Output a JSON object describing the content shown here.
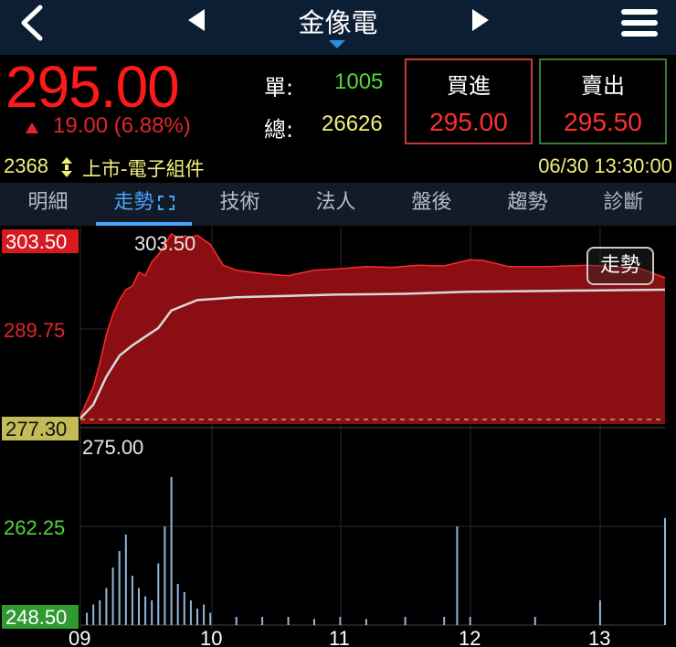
{
  "header": {
    "title": "金像電",
    "back_icon": "chevron-left-icon",
    "prev_icon": "triangle-left-icon",
    "next_icon": "triangle-right-icon",
    "menu_icon": "hamburger-menu-icon",
    "dropdown_icon": "caret-down-icon"
  },
  "quote": {
    "price": "295.00",
    "change": "19.00 (6.88%)",
    "single_label": "單:",
    "single_value": "1005",
    "total_label": "總:",
    "total_value": "26626",
    "buy_label": "買進",
    "buy_price": "295.00",
    "sell_label": "賣出",
    "sell_price": "295.50"
  },
  "info": {
    "code": "2368",
    "market": "上市-電子組件",
    "datetime": "06/30 13:30:00"
  },
  "tabs": [
    {
      "label": "明細"
    },
    {
      "label": "走勢"
    },
    {
      "label": "技術"
    },
    {
      "label": "法人"
    },
    {
      "label": "盤後"
    },
    {
      "label": "趨勢"
    },
    {
      "label": "診斷"
    }
  ],
  "active_tab": "走勢",
  "mode_button": "走勢",
  "colors": {
    "up": "#ff1a1a",
    "area": "#8b0f12",
    "avg_line": "#d8d8d8",
    "volume": "#8fb7df",
    "green": "#55d43f",
    "yellow": "#f3ef7c"
  },
  "chart_data": {
    "type": "line",
    "price_axis_labels": [
      "303.50",
      "289.75",
      "277.30"
    ],
    "volume_axis_labels": [
      "275.00",
      "262.25",
      "248.50"
    ],
    "high_annotation": "303.50",
    "x_labels": [
      "09",
      "10",
      "11",
      "12",
      "13"
    ],
    "price_range": [
      276.2,
      303.5
    ],
    "reference_price": 276.0,
    "price_series": [
      [
        9.0,
        277.3
      ],
      [
        9.05,
        279.5
      ],
      [
        9.1,
        281.5
      ],
      [
        9.15,
        285.0
      ],
      [
        9.2,
        289.0
      ],
      [
        9.25,
        292.0
      ],
      [
        9.3,
        294.0
      ],
      [
        9.35,
        295.5
      ],
      [
        9.4,
        296.0
      ],
      [
        9.45,
        298.0
      ],
      [
        9.5,
        297.5
      ],
      [
        9.55,
        299.5
      ],
      [
        9.6,
        300.5
      ],
      [
        9.65,
        302.0
      ],
      [
        9.7,
        303.5
      ],
      [
        9.75,
        303.0
      ],
      [
        9.8,
        303.2
      ],
      [
        9.85,
        303.0
      ],
      [
        9.9,
        303.3
      ],
      [
        10.0,
        302.0
      ],
      [
        10.1,
        299.0
      ],
      [
        10.2,
        298.3
      ],
      [
        10.4,
        297.8
      ],
      [
        10.6,
        297.5
      ],
      [
        10.8,
        298.3
      ],
      [
        11.0,
        298.5
      ],
      [
        11.2,
        298.8
      ],
      [
        11.4,
        298.7
      ],
      [
        11.6,
        299.0
      ],
      [
        11.8,
        298.9
      ],
      [
        12.0,
        299.8
      ],
      [
        12.1,
        299.7
      ],
      [
        12.3,
        298.8
      ],
      [
        12.6,
        298.8
      ],
      [
        12.9,
        299.0
      ],
      [
        13.1,
        298.8
      ],
      [
        13.3,
        298.6
      ],
      [
        13.5,
        297.2
      ]
    ],
    "avg_series": [
      [
        9.0,
        277.0
      ],
      [
        9.1,
        279.0
      ],
      [
        9.2,
        283.0
      ],
      [
        9.3,
        286.0
      ],
      [
        9.4,
        287.5
      ],
      [
        9.6,
        290.0
      ],
      [
        9.7,
        292.5
      ],
      [
        9.9,
        294.0
      ],
      [
        10.2,
        294.4
      ],
      [
        10.6,
        294.6
      ],
      [
        11.0,
        294.8
      ],
      [
        11.5,
        294.9
      ],
      [
        12.0,
        295.2
      ],
      [
        12.5,
        295.3
      ],
      [
        13.0,
        295.4
      ],
      [
        13.5,
        295.5
      ]
    ],
    "volume": [
      [
        9.05,
        3
      ],
      [
        9.1,
        5
      ],
      [
        9.15,
        6
      ],
      [
        9.2,
        9
      ],
      [
        9.25,
        14
      ],
      [
        9.3,
        18
      ],
      [
        9.35,
        22
      ],
      [
        9.4,
        12
      ],
      [
        9.45,
        9
      ],
      [
        9.5,
        7
      ],
      [
        9.55,
        6
      ],
      [
        9.6,
        15
      ],
      [
        9.65,
        24
      ],
      [
        9.7,
        36
      ],
      [
        9.75,
        10
      ],
      [
        9.8,
        8
      ],
      [
        9.85,
        6
      ],
      [
        9.9,
        4
      ],
      [
        9.95,
        5
      ],
      [
        10.0,
        3
      ],
      [
        10.2,
        2
      ],
      [
        10.4,
        2
      ],
      [
        10.6,
        2
      ],
      [
        10.8,
        1.5
      ],
      [
        11.0,
        2
      ],
      [
        11.2,
        1.5
      ],
      [
        11.5,
        2
      ],
      [
        11.8,
        2
      ],
      [
        11.9,
        24
      ],
      [
        12.0,
        2
      ],
      [
        12.5,
        2
      ],
      [
        13.0,
        6
      ],
      [
        13.5,
        26
      ]
    ]
  }
}
